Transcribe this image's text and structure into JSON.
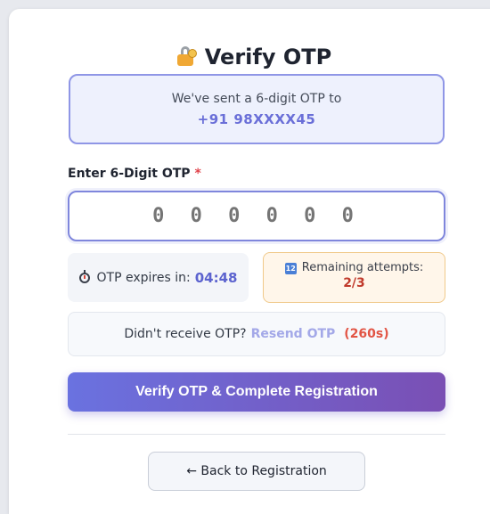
{
  "header": {
    "title": "Verify OTP",
    "icon": "lock-key-icon"
  },
  "info": {
    "message": "We've sent a 6-digit OTP to",
    "phone": "+91 98XXXX45"
  },
  "otp": {
    "label": "Enter 6-Digit OTP",
    "required_mark": "*",
    "value": "000000",
    "placeholder": "0 0 0 0 0 0"
  },
  "expiry": {
    "label": "OTP expires in:",
    "time": "04:48",
    "icon": "stopwatch-icon"
  },
  "attempts": {
    "label": "Remaining attempts:",
    "count": "2/3",
    "icon": "numbers-icon"
  },
  "resend": {
    "prompt": "Didn't receive OTP?",
    "link": "Resend OTP",
    "timer": "(260s)"
  },
  "actions": {
    "verify_label": "Verify OTP & Complete Registration",
    "back_label": "← Back to Registration"
  },
  "colors": {
    "accent": "#6a72e0",
    "accent_end": "#7a4fb4",
    "danger": "#e25545",
    "info_bg": "#eef1fd",
    "warning_bg": "#fff6ea"
  }
}
